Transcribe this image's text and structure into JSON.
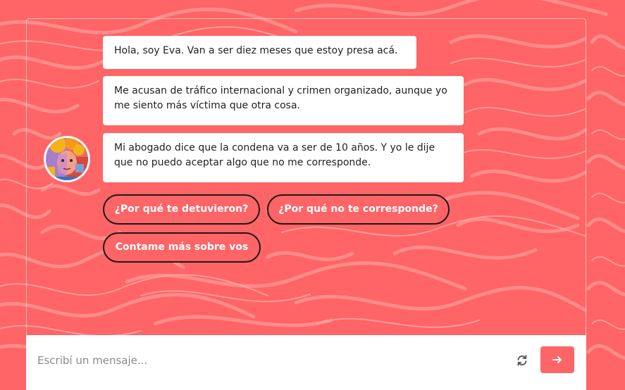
{
  "chat": {
    "messages": [
      {
        "text": "Hola, soy Eva. Van a ser diez meses que estoy presa acá."
      },
      {
        "text": "Me acusan de tráfico internacional y crimen organizado, aunque yo me siento más víctima que otra cosa."
      },
      {
        "text": "Mi abogado dice que la condena va a ser de 10 años. Y yo le dije que no puedo aceptar algo que no me corresponde."
      }
    ],
    "avatar_icon": "eva-portrait-avatar",
    "quick_replies": [
      {
        "label": "¿Por qué te detuvieron?"
      },
      {
        "label": "¿Por qué no te corresponde?"
      },
      {
        "label": "Contame más sobre vos"
      }
    ]
  },
  "composer": {
    "placeholder": "Escribí un mensaje...",
    "value": "",
    "refresh_icon": "refresh-icon",
    "send_icon": "arrow-right-icon"
  },
  "theme": {
    "accent": "#ff6466",
    "bubble_bg": "#ffffff",
    "chip_border": "#1a1a1a"
  }
}
